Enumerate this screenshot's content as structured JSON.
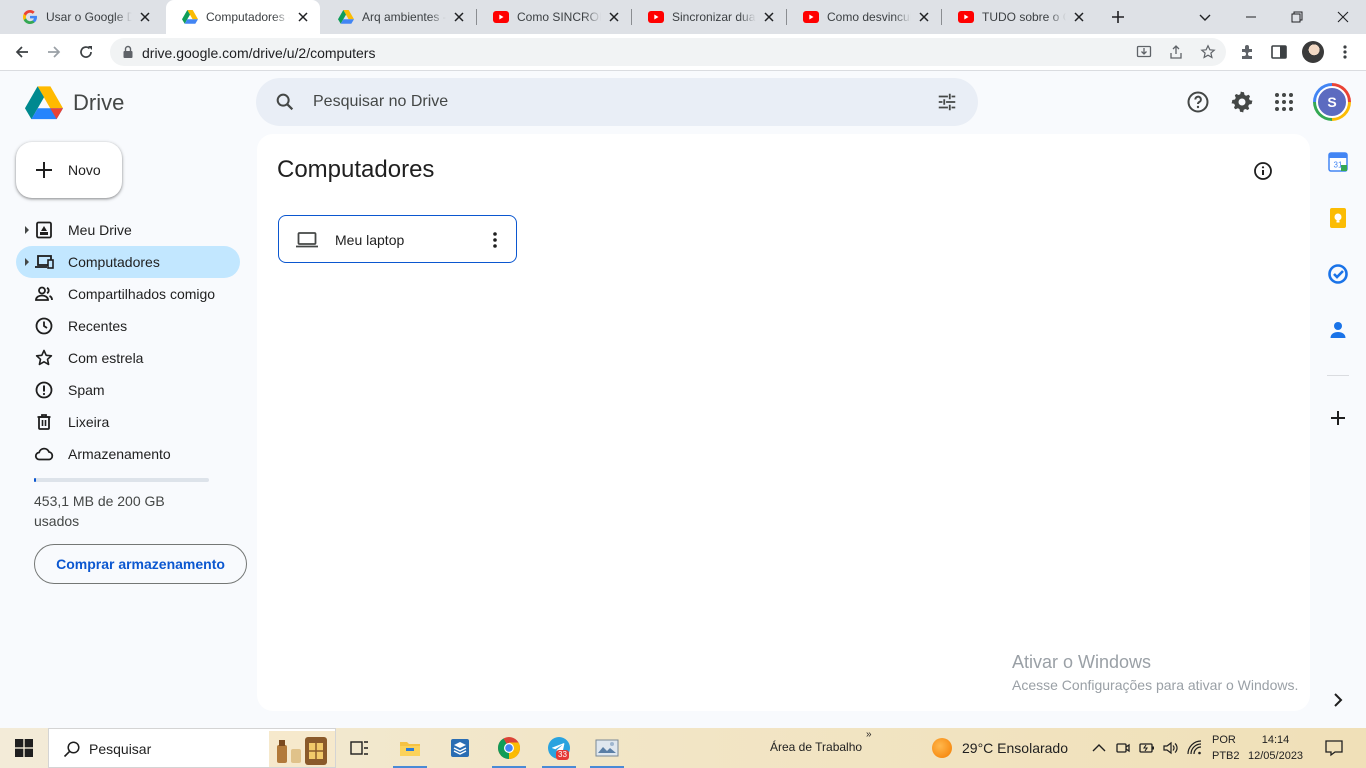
{
  "browser": {
    "tabs": [
      {
        "title": "Usar o Google Drive",
        "icon": "google-g-icon"
      },
      {
        "title": "Computadores - Google Drive",
        "icon": "drive-icon",
        "active": true
      },
      {
        "title": "Arq ambientes - Google Drive",
        "icon": "drive-icon"
      },
      {
        "title": "Como SINCRONIZAR",
        "icon": "youtube-icon"
      },
      {
        "title": "Sincronizar duas pastas",
        "icon": "youtube-icon"
      },
      {
        "title": "Como desvincular",
        "icon": "youtube-icon"
      },
      {
        "title": "TUDO sobre o GOOGLE",
        "icon": "youtube-icon"
      }
    ],
    "url": "drive.google.com/drive/u/2/computers"
  },
  "drive": {
    "logo_text": "Drive",
    "search_placeholder": "Pesquisar no Drive",
    "avatar_letter": "S",
    "new_label": "Novo",
    "nav": [
      {
        "label": "Meu Drive",
        "icon": "my-drive-icon"
      },
      {
        "label": "Computadores",
        "icon": "computers-icon",
        "selected": true
      },
      {
        "label": "Compartilhados comigo",
        "icon": "shared-icon"
      },
      {
        "label": "Recentes",
        "icon": "clock-icon"
      },
      {
        "label": "Com estrela",
        "icon": "star-icon"
      },
      {
        "label": "Spam",
        "icon": "spam-icon"
      },
      {
        "label": "Lixeira",
        "icon": "trash-icon"
      },
      {
        "label": "Armazenamento",
        "icon": "cloud-icon"
      }
    ],
    "storage_fraction": 0.0023,
    "storage_text": "453,1 MB de 200 GB usados",
    "buy_storage_label": "Comprar armazenamento",
    "page_title": "Computadores",
    "computers": [
      {
        "name": "Meu laptop",
        "icon": "laptop-icon"
      }
    ]
  },
  "watermark": {
    "line1": "Ativar o Windows",
    "line2": "Acesse Configurações para ativar o Windows."
  },
  "taskbar": {
    "search_label": "Pesquisar",
    "desktop_label": "Área de Trabalho",
    "weather": "29°C  Ensolarado",
    "lang1": "POR",
    "lang2": "PTB2",
    "time": "14:14",
    "date": "12/05/2023",
    "telegram_badge": "33"
  },
  "colors": {
    "accent": "#0b57d0",
    "nav_selected": "#c2e7ff"
  }
}
